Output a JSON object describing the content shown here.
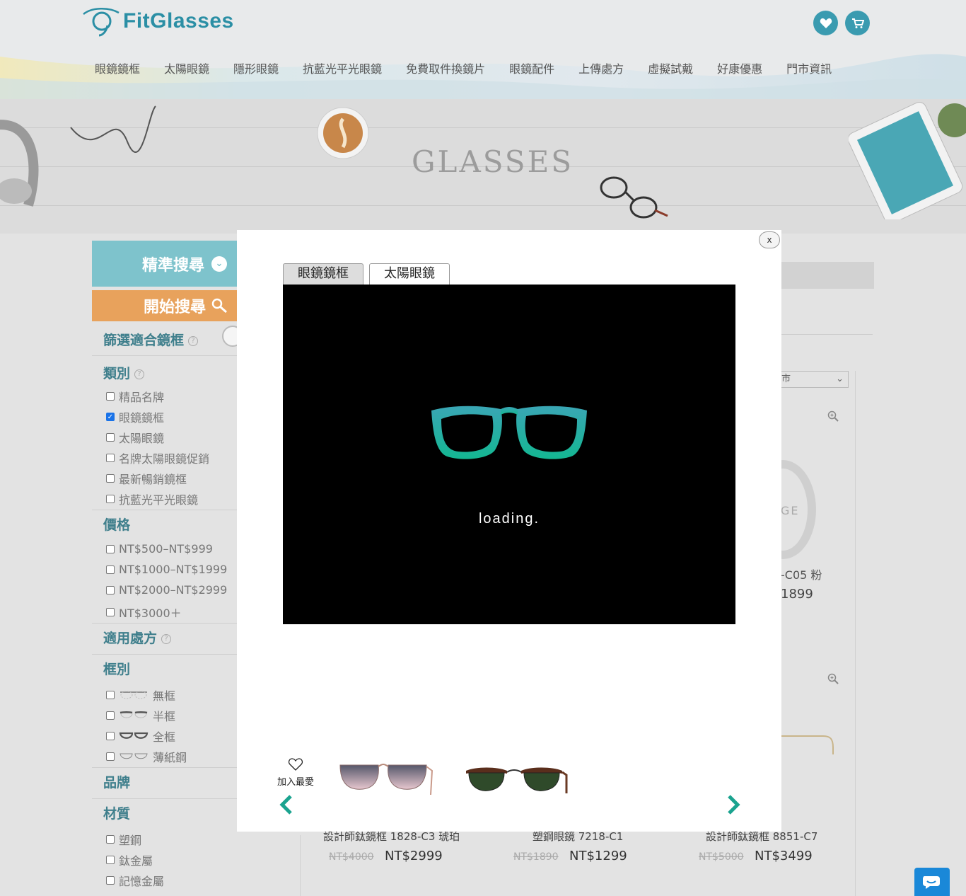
{
  "header": {
    "logo_text": "FitGlasses",
    "nav": [
      "眼鏡鏡框",
      "太陽眼鏡",
      "隱形眼鏡",
      "抗藍光平光眼鏡",
      "免費取件換鏡片",
      "眼鏡配件",
      "上傳處方",
      "虛擬試戴",
      "好康優惠",
      "門市資訊"
    ],
    "favorite_icon": "heart-icon",
    "cart_icon": "cart-icon"
  },
  "banner": {
    "title": "GLASSES"
  },
  "sidebar": {
    "precise_search_label": "精準搜尋",
    "start_search_label": "開始搜尋",
    "filter_fit_label": "篩選適合鏡框",
    "category": {
      "title": "類別",
      "options": [
        {
          "label": "精品名牌",
          "checked": false
        },
        {
          "label": "眼鏡鏡框",
          "checked": true
        },
        {
          "label": "太陽眼鏡",
          "checked": false
        },
        {
          "label": "名牌太陽眼鏡促銷",
          "checked": false
        },
        {
          "label": "最新暢銷鏡框",
          "checked": false
        },
        {
          "label": "抗藍光平光眼鏡",
          "checked": false
        }
      ]
    },
    "price": {
      "title": "價格",
      "options": [
        "NT$500–NT$999",
        "NT$1000–NT$1999",
        "NT$2000–NT$2999",
        "NT$3000＋"
      ]
    },
    "prescription_title": "適用處方",
    "frame_type": {
      "title": "框別",
      "options": [
        "無框",
        "半框",
        "全框",
        "薄紙鋼"
      ]
    },
    "brand_title": "品牌",
    "material": {
      "title": "材質",
      "options": [
        "塑鋼",
        "鈦金屬",
        "記憶金屬"
      ]
    }
  },
  "background": {
    "sort_select_fragment": "市",
    "product_fragment_name": "-C05 粉",
    "product_fragment_price": "1899",
    "ring_text": "GE",
    "products": [
      {
        "name": "設計師鈦鏡框 1828-C3 琥珀",
        "old_price": "NT$4000",
        "price": "NT$2999"
      },
      {
        "name": "塑鋼眼鏡 7218-C1",
        "old_price": "NT$1890",
        "price": "NT$1299"
      },
      {
        "name": "設計師鈦鏡框 8851-C7",
        "old_price": "NT$5000",
        "price": "NT$3499"
      }
    ]
  },
  "modal": {
    "close_label": "x",
    "tabs": [
      {
        "label": "眼鏡鏡框",
        "active": true
      },
      {
        "label": "太陽眼鏡",
        "active": false
      }
    ],
    "loading_text": "loading.",
    "favorite_label": "加入最愛",
    "thumbnails": [
      "sunglasses-gradient-thumb",
      "sunglasses-clubmaster-thumb"
    ]
  },
  "colors": {
    "brand": "#3a9bb0",
    "precise_button": "#7ec3cc",
    "search_button": "#e8a25c",
    "arrow": "#1aa38f",
    "chat": "#1a88d8"
  }
}
